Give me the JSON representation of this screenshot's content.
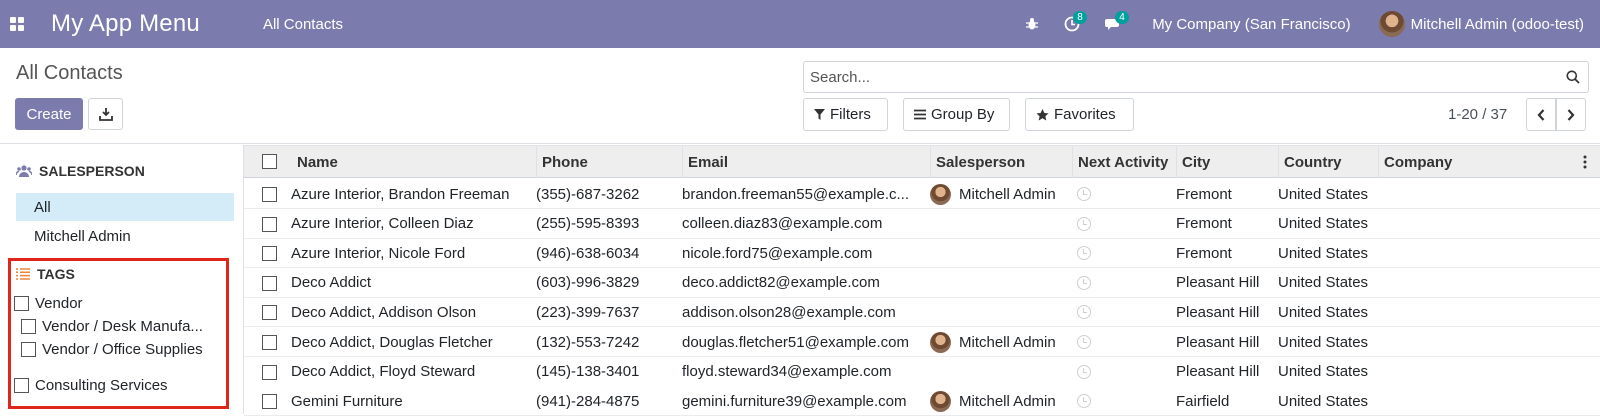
{
  "navbar": {
    "app_title": "My App Menu",
    "nav_link": "All Contacts",
    "activity_badge": "8",
    "messages_badge": "4",
    "company": "My Company (San Francisco)",
    "user": "Mitchell Admin (odoo-test)",
    "bg_color": "#7c7bad",
    "badge_color": "#00a09d"
  },
  "control": {
    "title": "All Contacts",
    "create_label": "Create",
    "search_placeholder": "Search...",
    "filters_label": "Filters",
    "group_by_label": "Group By",
    "favorites_label": "Favorites",
    "pager": "1-20 / 37"
  },
  "sidebar": {
    "salesperson_heading": "SALESPERSON",
    "salesperson_items": [
      "All",
      "Mitchell Admin"
    ],
    "tags_heading": "TAGS",
    "tags": [
      "Vendor",
      "Vendor / Desk Manufa...",
      "Vendor / Office Supplies",
      "Consulting Services"
    ]
  },
  "table": {
    "columns": [
      "Name",
      "Phone",
      "Email",
      "Salesperson",
      "Next Activity",
      "City",
      "Country",
      "Company"
    ],
    "rows": [
      {
        "name": "Azure Interior, Brandon Freeman",
        "phone": "(355)-687-3262",
        "email": "brandon.freeman55@example.c...",
        "salesperson": "Mitchell Admin",
        "city": "Fremont",
        "country": "United States",
        "company": ""
      },
      {
        "name": "Azure Interior, Colleen Diaz",
        "phone": "(255)-595-8393",
        "email": "colleen.diaz83@example.com",
        "salesperson": "",
        "city": "Fremont",
        "country": "United States",
        "company": ""
      },
      {
        "name": "Azure Interior, Nicole Ford",
        "phone": "(946)-638-6034",
        "email": "nicole.ford75@example.com",
        "salesperson": "",
        "city": "Fremont",
        "country": "United States",
        "company": ""
      },
      {
        "name": "Deco Addict",
        "phone": "(603)-996-3829",
        "email": "deco.addict82@example.com",
        "salesperson": "",
        "city": "Pleasant Hill",
        "country": "United States",
        "company": ""
      },
      {
        "name": "Deco Addict, Addison Olson",
        "phone": "(223)-399-7637",
        "email": "addison.olson28@example.com",
        "salesperson": "",
        "city": "Pleasant Hill",
        "country": "United States",
        "company": ""
      },
      {
        "name": "Deco Addict, Douglas Fletcher",
        "phone": "(132)-553-7242",
        "email": "douglas.fletcher51@example.com",
        "salesperson": "Mitchell Admin",
        "city": "Pleasant Hill",
        "country": "United States",
        "company": ""
      },
      {
        "name": "Deco Addict, Floyd Steward",
        "phone": "(145)-138-3401",
        "email": "floyd.steward34@example.com",
        "salesperson": "",
        "city": "Pleasant Hill",
        "country": "United States",
        "company": ""
      },
      {
        "name": "Gemini Furniture",
        "phone": "(941)-284-4875",
        "email": "gemini.furniture39@example.com",
        "salesperson": "Mitchell Admin",
        "city": "Fairfield",
        "country": "United States",
        "company": ""
      }
    ]
  }
}
